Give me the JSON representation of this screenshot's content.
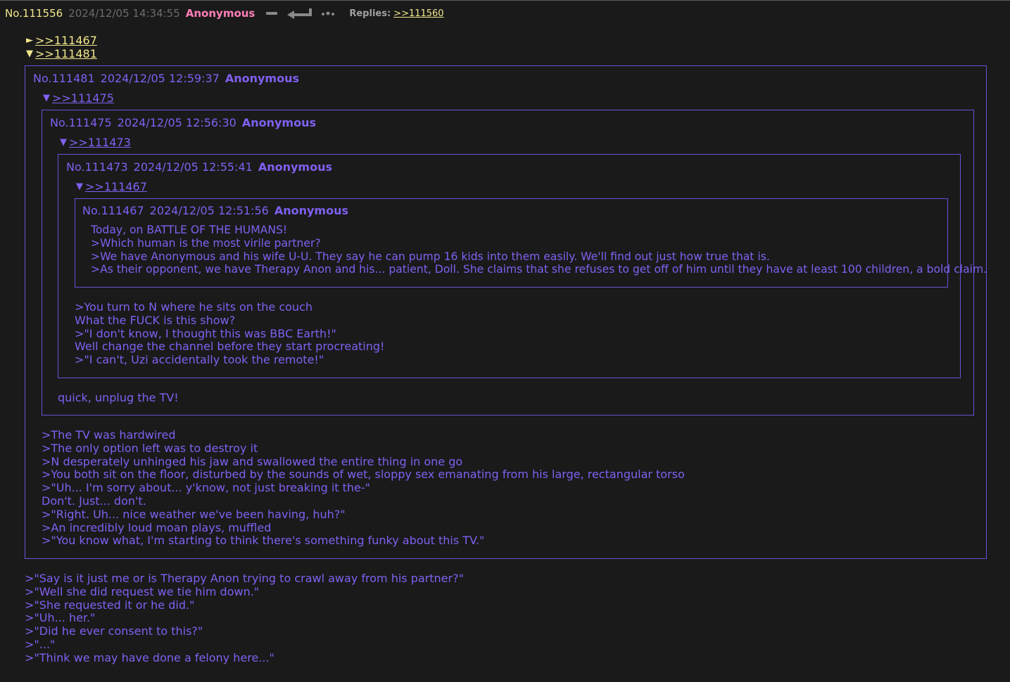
{
  "header": {
    "post_no": "No.111556",
    "date": "2024/12/05 14:34:55",
    "name": "Anonymous",
    "replies_label": "Replies:",
    "reply_link": ">>111560",
    "icons": [
      "minus-icon",
      "reply-arrow-icon",
      "more-icon"
    ]
  },
  "top_quotes": [
    {
      "arrow": "►",
      "link": ">>111467"
    },
    {
      "arrow": "▼",
      "link": ">>111481"
    }
  ],
  "post_111481": {
    "no": "No.111481",
    "date": "2024/12/05 12:59:37",
    "name": "Anonymous",
    "quote_arrow": "▼",
    "quote_link": ">>111475",
    "lines": [
      ">The TV was hardwired",
      ">The only option left was to destroy it",
      ">N desperately unhinged his jaw and swallowed the entire thing in one go",
      ">You both sit on the floor, disturbed by the sounds of wet, sloppy sex emanating from his large, rectangular torso",
      ">\"Uh... I'm sorry about... y'know, not just breaking it the-\"",
      "Don't. Just... don't.",
      ">\"Right. Uh... nice weather we've been having, huh?\"",
      ">An incredibly loud moan plays, muffled",
      ">\"You know what, I'm starting to think there's something funky about this TV.\""
    ]
  },
  "post_111475": {
    "no": "No.111475",
    "date": "2024/12/05 12:56:30",
    "name": "Anonymous",
    "quote_arrow": "▼",
    "quote_link": ">>111473",
    "lines": [
      "quick, unplug the TV!"
    ]
  },
  "post_111473": {
    "no": "No.111473",
    "date": "2024/12/05 12:55:41",
    "name": "Anonymous",
    "quote_arrow": "▼",
    "quote_link": ">>111467",
    "lines": [
      ">You turn to N where he sits on the couch",
      "What the FUCK is this show?",
      ">\"I don't know, I thought this was BBC Earth!\"",
      "Well change the channel before they start procreating!",
      ">\"I can't, Uzi accidentally took the remote!\""
    ]
  },
  "post_111467": {
    "no": "No.111467",
    "date": "2024/12/05 12:51:56",
    "name": "Anonymous",
    "lines": [
      "Today, on BATTLE OF THE HUMANS!",
      ">Which human is the most virile partner?",
      ">We have Anonymous and his wife U-U. They say he can pump 16 kids into them easily. We'll find out just how true that is.",
      ">As their opponent, we have Therapy Anon and his... patient, Doll. She claims that she refuses to get off of him until they have at least 100 children, a bold claim."
    ]
  },
  "body_lines": [
    ">\"Say is it just me or is Therapy Anon trying to crawl away from his partner?\"",
    ">\"Well she did request we tie him down.\"",
    ">\"She requested it or he did.\"",
    ">\"Uh... her.\"",
    ">\"Did he ever consent to this?\"",
    ">\"...\"",
    ">\"Think we may have done a felony here...\""
  ]
}
